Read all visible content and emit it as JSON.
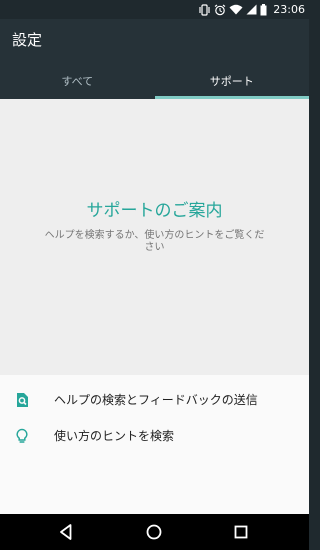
{
  "status_bar": {
    "time": "23:06",
    "icons": [
      "vibrate-icon",
      "alarm-icon",
      "wifi-icon",
      "cellular-icon",
      "battery-icon"
    ]
  },
  "app_bar": {
    "title": "設定",
    "tabs": [
      {
        "label": "すべて",
        "active": false
      },
      {
        "label": "サポート",
        "active": true
      }
    ]
  },
  "hero": {
    "title": "サポートのご案内",
    "subtitle": "ヘルプを検索するか、使い方のヒントをご覧ください"
  },
  "list": {
    "items": [
      {
        "label": "ヘルプの検索とフィードバックの送信",
        "icon": "help-search-icon"
      },
      {
        "label": "使い方のヒントを検索",
        "icon": "lightbulb-icon"
      }
    ]
  },
  "nav_bar": {
    "buttons": [
      "back-icon",
      "home-icon",
      "recents-icon"
    ]
  },
  "colors": {
    "status_bar": "#1f292e",
    "app_bar": "#263238",
    "accent": "#26a69a",
    "tab_indicator": "#80cbc4"
  }
}
